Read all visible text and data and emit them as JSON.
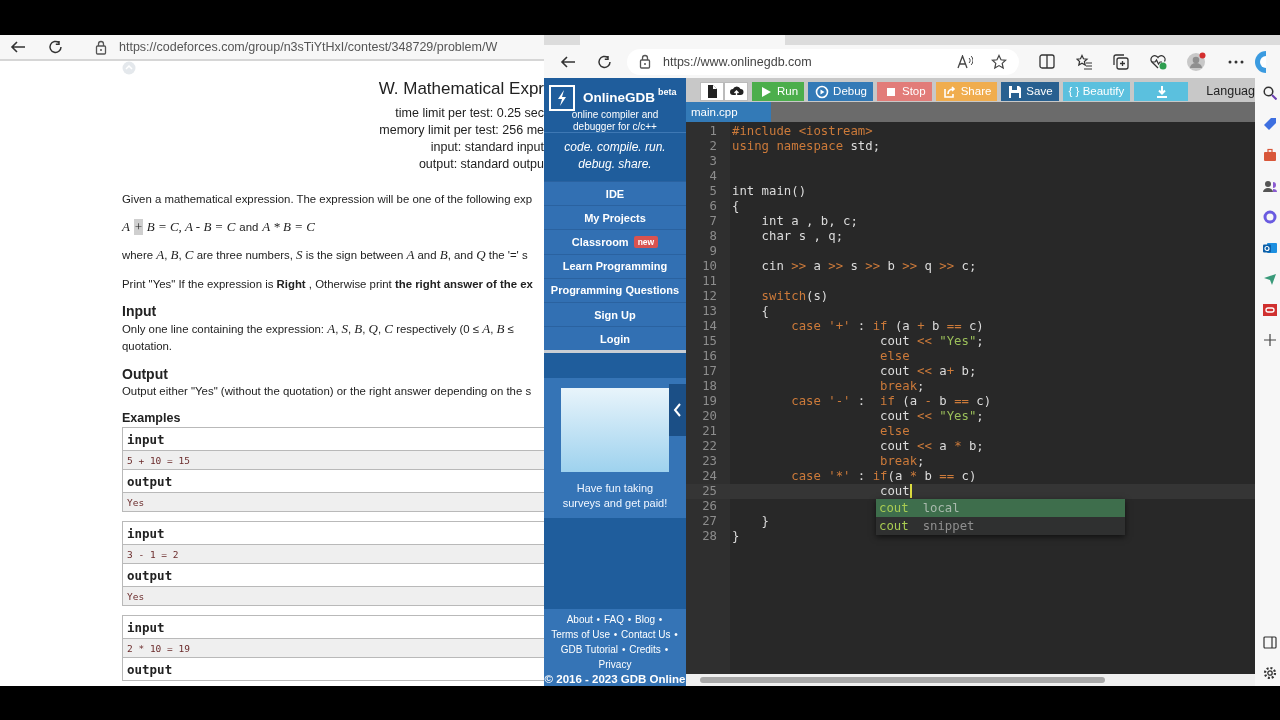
{
  "left_browser": {
    "url": "https://codeforces.com/group/n3sTiYtHxI/contest/348729/problem/W",
    "problem": {
      "title": "W. Mathematical Expr",
      "limits": [
        "time limit per test: 0.25 sec",
        "memory limit per test: 256 me",
        "input: standard input",
        "output: standard outpu"
      ],
      "intro": "Given a mathematical expression. The expression will be one of the following exp",
      "formula": [
        {
          "kind": "math",
          "text": "A",
          "highlighted": false
        },
        {
          "kind": "math",
          "text": "+",
          "highlighted": true
        },
        {
          "kind": "math",
          "text": "B = C, A - B = C",
          "highlighted": false
        },
        {
          "kind": "text",
          "text": "and",
          "highlighted": false
        },
        {
          "kind": "math",
          "text": "A * B = C",
          "highlighted": false
        }
      ],
      "definitions": "where *A*, *B*, *C* are three numbers, *S* is the sign between *A* and *B*, and *Q* the '=' s",
      "instruction": "Print \"Yes\" If the expression is **Right** , Otherwise print **the right answer of the ex**",
      "input_heading": "Input",
      "input_text": [
        "Only one line containing the expression: *A*, *S*, *B*, *Q*, *C* respectively (0 ≤ *A*, *B* ≤",
        "quotation."
      ],
      "output_heading": "Output",
      "output_text": "Output either \"Yes\" (without the quotation) or the right answer depending on the s",
      "examples_heading": "Examples",
      "examples": [
        {
          "input_label": "input",
          "input": "5 + 10 = 15",
          "output_label": "output",
          "output": "Yes"
        },
        {
          "input_label": "input",
          "input": "3 - 1 = 2",
          "output_label": "output",
          "output": "Yes"
        },
        {
          "input_label": "input",
          "input": "2 * 10 = 19",
          "output_label": "output"
        }
      ]
    }
  },
  "right_browser": {
    "url": "https://www.onlinegdb.com",
    "sidebar": {
      "brand": "OnlineGDB",
      "brand_badge": "beta",
      "subtitle": "online compiler and debugger for c/c++",
      "tagline": "code. compile. run. debug. share.",
      "nav": [
        {
          "label": "IDE"
        },
        {
          "label": "My Projects"
        },
        {
          "label": "Classroom",
          "badge": "new"
        },
        {
          "label": "Learn Programming"
        },
        {
          "label": "Programming Questions"
        },
        {
          "label": "Sign Up"
        },
        {
          "label": "Login"
        }
      ],
      "ad_text": "Have fun taking surveys and get paid!",
      "footer_links": [
        "About",
        "FAQ",
        "Blog",
        "Terms of Use",
        "Contact Us",
        "GDB Tutorial",
        "Credits",
        "Privacy"
      ],
      "footer_separator": "•",
      "copyright": "© 2016 - 2023 GDB Online"
    },
    "toolbar": {
      "buttons": [
        {
          "kind": "new-file"
        },
        {
          "kind": "upload"
        },
        {
          "kind": "run",
          "label": "Run"
        },
        {
          "kind": "debug",
          "label": "Debug"
        },
        {
          "kind": "stop",
          "label": "Stop"
        },
        {
          "kind": "share",
          "label": "Share"
        },
        {
          "kind": "save",
          "label": "Save"
        },
        {
          "kind": "beautify",
          "label": "{ } Beautify"
        },
        {
          "kind": "download"
        }
      ],
      "language_label": "Languag"
    },
    "file_tab": "main.cpp",
    "editor": {
      "lines": [
        {
          "number": "1",
          "current": false,
          "tokens": [
            {
              "kind": "kw",
              "text": "#include <iostream>"
            }
          ]
        },
        {
          "number": "2",
          "current": false,
          "tokens": [
            {
              "kind": "kw",
              "text": "using namespace"
            },
            {
              "kind": "id",
              "text": " std;"
            }
          ]
        },
        {
          "number": "3",
          "current": false
        },
        {
          "number": "4",
          "current": false
        },
        {
          "number": "5",
          "current": false,
          "tokens": [
            {
              "kind": "id",
              "text": "int main()"
            }
          ]
        },
        {
          "number": "6",
          "current": false,
          "tokens": [
            {
              "kind": "id",
              "text": "{"
            }
          ]
        },
        {
          "number": "7",
          "current": false,
          "tokens": [
            {
              "kind": "id",
              "text": "    int a , b, c;"
            }
          ]
        },
        {
          "number": "8",
          "current": false,
          "tokens": [
            {
              "kind": "id",
              "text": "    char s , q;"
            }
          ]
        },
        {
          "number": "9",
          "current": false
        },
        {
          "number": "10",
          "current": false,
          "tokens": [
            {
              "kind": "id",
              "text": "    cin "
            },
            {
              "kind": "op",
              "text": ">>"
            },
            {
              "kind": "id",
              "text": " a "
            },
            {
              "kind": "op",
              "text": ">>"
            },
            {
              "kind": "id",
              "text": " s "
            },
            {
              "kind": "op",
              "text": ">>"
            },
            {
              "kind": "id",
              "text": " b "
            },
            {
              "kind": "op",
              "text": ">>"
            },
            {
              "kind": "id",
              "text": " q "
            },
            {
              "kind": "op",
              "text": ">>"
            },
            {
              "kind": "id",
              "text": " c;"
            }
          ]
        },
        {
          "number": "11",
          "current": false
        },
        {
          "number": "12",
          "current": false,
          "tokens": [
            {
              "kind": "kw",
              "text": "    switch"
            },
            {
              "kind": "id",
              "text": "(s)"
            }
          ]
        },
        {
          "number": "13",
          "current": false,
          "tokens": [
            {
              "kind": "id",
              "text": "    {"
            }
          ]
        },
        {
          "number": "14",
          "current": false,
          "tokens": [
            {
              "kind": "kw",
              "text": "        case '+'"
            },
            {
              "kind": "id",
              "text": " : "
            },
            {
              "kind": "kw",
              "text": "if"
            },
            {
              "kind": "id",
              "text": " (a "
            },
            {
              "kind": "op",
              "text": "+"
            },
            {
              "kind": "id",
              "text": " b "
            },
            {
              "kind": "op",
              "text": "=="
            },
            {
              "kind": "id",
              "text": " c)"
            }
          ]
        },
        {
          "number": "15",
          "current": false,
          "tokens": [
            {
              "kind": "id",
              "text": "                    cout "
            },
            {
              "kind": "op",
              "text": "<<"
            },
            {
              "kind": "str",
              "text": " \"Yes\""
            },
            {
              "kind": "id",
              "text": ";"
            }
          ]
        },
        {
          "number": "16",
          "current": false,
          "tokens": [
            {
              "kind": "kw",
              "text": "                    else"
            }
          ]
        },
        {
          "number": "17",
          "current": false,
          "tokens": [
            {
              "kind": "id",
              "text": "                    cout "
            },
            {
              "kind": "op",
              "text": "<<"
            },
            {
              "kind": "id",
              "text": " a"
            },
            {
              "kind": "op",
              "text": "+"
            },
            {
              "kind": "id",
              "text": " b;"
            }
          ]
        },
        {
          "number": "18",
          "current": false,
          "tokens": [
            {
              "kind": "kw",
              "text": "                    break"
            },
            {
              "kind": "id",
              "text": ";"
            }
          ]
        },
        {
          "number": "19",
          "current": false,
          "tokens": [
            {
              "kind": "kw",
              "text": "        case '-'"
            },
            {
              "kind": "id",
              "text": " :  "
            },
            {
              "kind": "kw",
              "text": "if"
            },
            {
              "kind": "id",
              "text": " (a "
            },
            {
              "kind": "op",
              "text": "-"
            },
            {
              "kind": "id",
              "text": " b "
            },
            {
              "kind": "op",
              "text": "=="
            },
            {
              "kind": "id",
              "text": " c)"
            }
          ]
        },
        {
          "number": "20",
          "current": false,
          "tokens": [
            {
              "kind": "id",
              "text": "                    cout "
            },
            {
              "kind": "op",
              "text": "<<"
            },
            {
              "kind": "str",
              "text": " \"Yes\""
            },
            {
              "kind": "id",
              "text": ";"
            }
          ]
        },
        {
          "number": "21",
          "current": false,
          "tokens": [
            {
              "kind": "kw",
              "text": "                    else"
            }
          ]
        },
        {
          "number": "22",
          "current": false,
          "tokens": [
            {
              "kind": "id",
              "text": "                    cout "
            },
            {
              "kind": "op",
              "text": "<<"
            },
            {
              "kind": "id",
              "text": " a "
            },
            {
              "kind": "op",
              "text": "*"
            },
            {
              "kind": "id",
              "text": " b;"
            }
          ]
        },
        {
          "number": "23",
          "current": false,
          "tokens": [
            {
              "kind": "kw",
              "text": "                    break"
            },
            {
              "kind": "id",
              "text": ";"
            }
          ]
        },
        {
          "number": "24",
          "current": false,
          "tokens": [
            {
              "kind": "kw",
              "text": "        case '*'"
            },
            {
              "kind": "id",
              "text": " : "
            },
            {
              "kind": "kw",
              "text": "if"
            },
            {
              "kind": "id",
              "text": "(a "
            },
            {
              "kind": "op",
              "text": "*"
            },
            {
              "kind": "id",
              "text": " b "
            },
            {
              "kind": "op",
              "text": "=="
            },
            {
              "kind": "id",
              "text": " c)"
            }
          ]
        },
        {
          "number": "25",
          "current": true,
          "tokens": [
            {
              "kind": "id",
              "text": "                    cout"
            }
          ]
        },
        {
          "number": "26",
          "current": false
        },
        {
          "number": "27",
          "current": false,
          "tokens": [
            {
              "kind": "id",
              "text": "    }"
            }
          ]
        },
        {
          "number": "28",
          "current": false,
          "tokens": [
            {
              "kind": "id",
              "text": "}"
            }
          ]
        }
      ],
      "autocomplete": [
        {
          "name": "cout",
          "meta": "local",
          "selected": true
        },
        {
          "name": "cout",
          "meta": "snippet",
          "selected": false
        }
      ]
    }
  }
}
